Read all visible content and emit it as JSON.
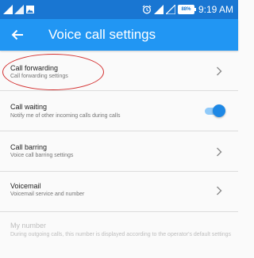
{
  "status_bar": {
    "battery_percent": "88%",
    "time": "9:19 AM",
    "left_icons": [
      "signal-icon",
      "signal-icon",
      "image-notification-icon"
    ],
    "right_icons": [
      "alarm-icon",
      "signal-icon",
      "signal-no-data-icon",
      "battery-icon"
    ]
  },
  "app_bar": {
    "title": "Voice call settings",
    "back_icon": "arrow-back-icon"
  },
  "settings": [
    {
      "title": "Call forwarding",
      "subtitle": "Call forwarding settings",
      "control": "chevron"
    },
    {
      "title": "Call waiting",
      "subtitle": "Notify me of other incoming calls during calls",
      "control": "toggle",
      "toggle_on": true
    },
    {
      "title": "Call barring",
      "subtitle": "Voice call barring settings",
      "control": "chevron"
    },
    {
      "title": "Voicemail",
      "subtitle": "Voicemail service and number",
      "control": "chevron"
    },
    {
      "title": "My number",
      "subtitle": "During outgoing calls, this number is displayed according to the operator's default settings",
      "control": "none",
      "disabled": true
    }
  ],
  "colors": {
    "status_bar": "#1976d2",
    "app_bar": "#2196f3",
    "accent": "#1e88e5",
    "highlight": "#d32f2f"
  }
}
